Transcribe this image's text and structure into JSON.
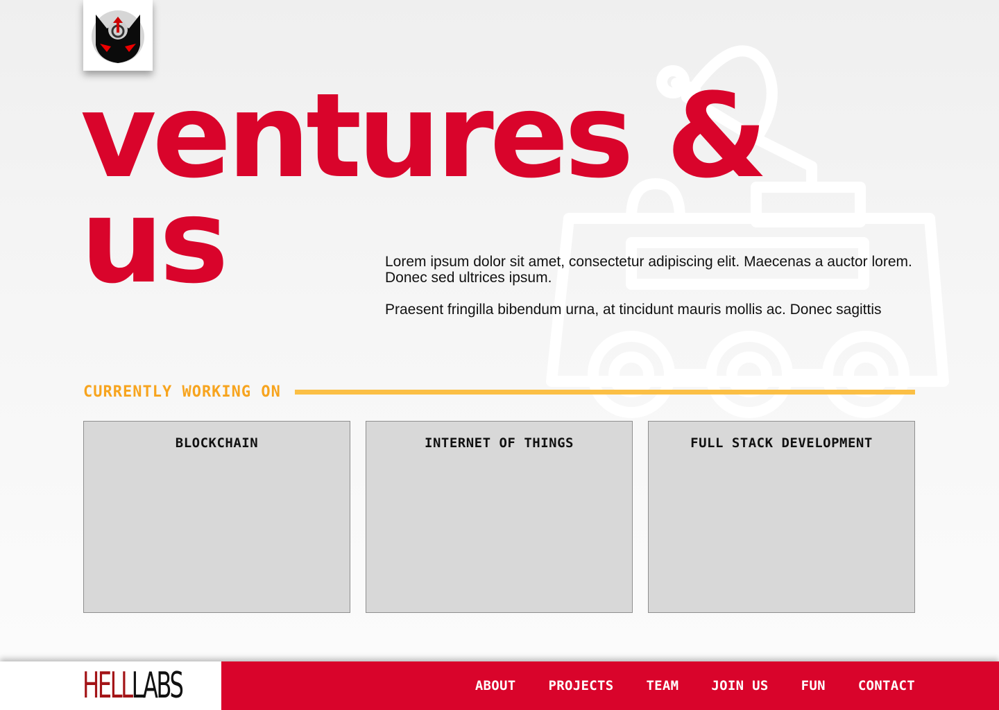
{
  "hero": {
    "title_line1": "ventures &",
    "title_line2": "us"
  },
  "intro": {
    "paragraph1": "Lorem ipsum dolor sit amet, consectetur adipiscing elit. Maecenas a auctor lorem. Donec sed ultrices ipsum.",
    "paragraph2": "Praesent fringilla bibendum urna, at tincidunt mauris mollis ac. Donec sagittis"
  },
  "section": {
    "heading": "CURRENTLY WORKING ON"
  },
  "cards": [
    {
      "title": "BLOCKCHAIN"
    },
    {
      "title": "INTERNET OF THINGS"
    },
    {
      "title": "FULL STACK DEVELOPMENT"
    }
  ],
  "footer": {
    "brand_hell": "HELL",
    "brand_labs": "LABS",
    "nav": [
      "ABOUT",
      "PROJECTS",
      "TEAM",
      "JOIN US",
      "FUN",
      "CONTACT"
    ]
  },
  "icons": {
    "logo": "demon-power-logo-icon",
    "background": "locomotive-outline-icon"
  },
  "colors": {
    "brand_red": "#d9042b",
    "accent_yellow": "#fbbf45",
    "heading_orange": "#f7a41e",
    "card_gray": "#d8d8d8"
  }
}
